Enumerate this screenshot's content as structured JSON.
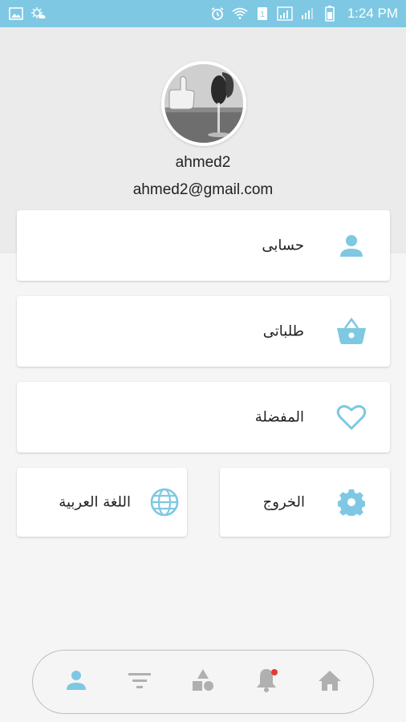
{
  "status_bar": {
    "time": "1:24 PM",
    "background_color": "#7ec8e3"
  },
  "profile": {
    "name": "ahmed2",
    "email": "ahmed2@gmail.com",
    "avatar_icon": "thumbs-up-photo"
  },
  "menu": {
    "account": {
      "label": "حسابى",
      "icon": "person-icon"
    },
    "orders": {
      "label": "طلباتى",
      "icon": "basket-icon"
    },
    "favorites": {
      "label": "المفضلة",
      "icon": "heart-icon"
    },
    "logout": {
      "label": "الخروج",
      "icon": "gear-icon"
    },
    "language": {
      "label": "اللغة العربية",
      "icon": "globe-icon"
    }
  },
  "bottom_nav": {
    "items": [
      {
        "name": "profile",
        "icon": "person-icon",
        "active": true
      },
      {
        "name": "filter",
        "icon": "filter-icon",
        "active": false
      },
      {
        "name": "categories",
        "icon": "shapes-icon",
        "active": false
      },
      {
        "name": "notifications",
        "icon": "bell-icon",
        "active": false,
        "badge": true
      },
      {
        "name": "home",
        "icon": "home-icon",
        "active": false
      }
    ]
  },
  "colors": {
    "accent": "#7ec8e3",
    "inactive_icon": "#b0b0b0",
    "badge": "#e53935"
  }
}
